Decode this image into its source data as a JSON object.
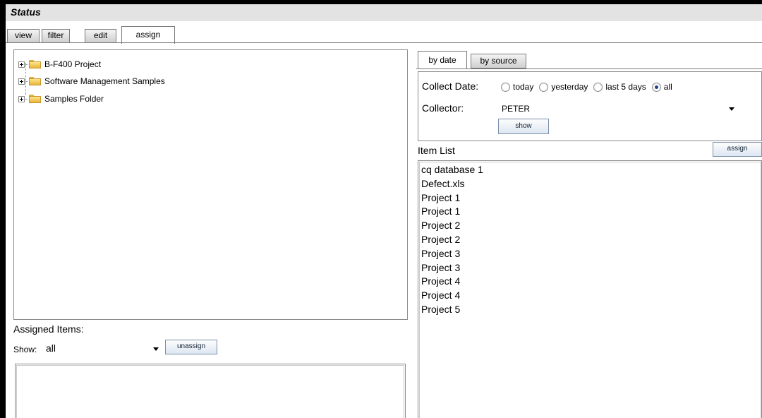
{
  "window": {
    "title": "Status"
  },
  "tabs": [
    {
      "label": "view"
    },
    {
      "label": "filter"
    },
    {
      "label": "edit"
    },
    {
      "label": "assign",
      "active": true
    }
  ],
  "tree": {
    "items": [
      {
        "label": "B-F400 Project"
      },
      {
        "label": "Software Management Samples"
      },
      {
        "label": "Samples Folder"
      }
    ]
  },
  "assigned": {
    "label": "Assigned Items:",
    "show_label": "Show:",
    "show_value": "all",
    "unassign_label": "unassign"
  },
  "subtabs": [
    {
      "label": "by date",
      "active": true
    },
    {
      "label": "by source"
    }
  ],
  "filter": {
    "collect_date_label": "Collect Date:",
    "options": [
      {
        "label": "today",
        "selected": false
      },
      {
        "label": "yesterday",
        "selected": false
      },
      {
        "label": "last 5 days",
        "selected": false
      },
      {
        "label": "all",
        "selected": true
      }
    ],
    "collector_label": "Collector:",
    "collector_value": "PETER",
    "show_button": "show"
  },
  "item_list": {
    "label": "Item List",
    "assign_button": "assign",
    "items": [
      "cq database 1",
      "Defect.xls",
      "Project 1",
      "Project 1",
      "Project 2",
      "Project 2",
      "Project 3",
      "Project 3",
      "Project 4",
      "Project 4",
      "Project 5"
    ]
  },
  "colors": {
    "titlebar": "#e3e3e3",
    "button_border": "#7b8ea8",
    "radio_selected": "#1f3f8a"
  }
}
